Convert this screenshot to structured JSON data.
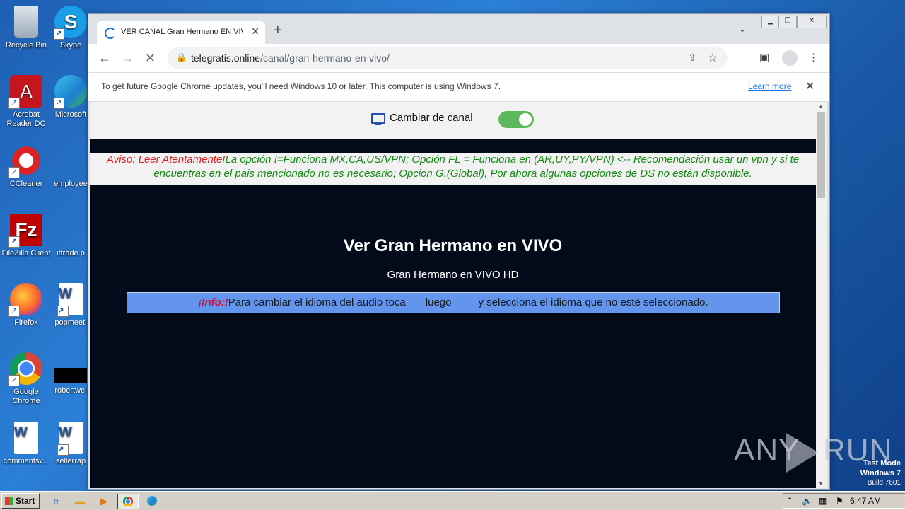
{
  "desktop": {
    "icons": [
      {
        "label": "Recycle Bin"
      },
      {
        "label": "Skype"
      },
      {
        "label": "Acrobat Reader DC"
      },
      {
        "label": "Microsoft"
      },
      {
        "label": "CCleaner"
      },
      {
        "label": "employee"
      },
      {
        "label": "FileZilla Client"
      },
      {
        "label": "ittrade.p"
      },
      {
        "label": "Firefox"
      },
      {
        "label": "popmeeti"
      },
      {
        "label": "Google Chrome"
      },
      {
        "label": "robertwel"
      },
      {
        "label": "commentsv..."
      },
      {
        "label": "sellerrap"
      }
    ]
  },
  "browser": {
    "tab_title": "VER CANAL Gran Hermano EN VIVO",
    "url_domain": "telegratis.online",
    "url_path": "/canal/gran-hermano-en-vivo/",
    "infobar_message": "To get future Google Chrome updates, you'll need Windows 10 or later. This computer is using Windows 7.",
    "infobar_link": "Learn more"
  },
  "page": {
    "channel_label": "Cambiar de canal",
    "toggle_on": true,
    "notice_warn": "Aviso: Leer Atentamente!",
    "notice_text": "La opción I=Funciona MX,CA,US/VPN; Opción FL = Funciona en (AR,UY,PY/VPN) <-- Recomendación usar un vpn y si te encuentras en el pais mencionado no es necesario; Opcion G.(Global), Por ahora algunas opciones de DS no están disponible.",
    "heading": "Ver Gran Hermano en VIVO",
    "subheading": "Gran Hermano en VIVO HD",
    "info_tag": "¡Info:!",
    "info_part1": "Para cambiar el idioma del audio toca",
    "info_part2": "luego",
    "info_part3": "y selecciona el idioma que no esté seleccionado."
  },
  "watermark": {
    "brand_left": "ANY",
    "brand_right": "RUN",
    "test_mode": "Test Mode",
    "os": "Windows 7",
    "build": "Build 7601"
  },
  "taskbar": {
    "start_label": "Start",
    "clock": "6:47 AM"
  }
}
